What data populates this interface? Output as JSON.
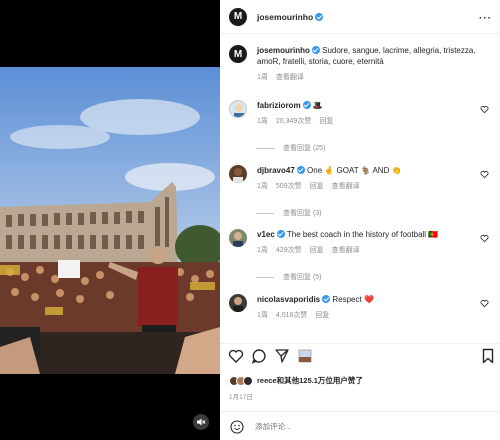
{
  "post": {
    "author": "josemourinho",
    "avatar_letter": "M"
  },
  "caption": {
    "username": "josemourinho",
    "text": "Sudore, sangue, lacrime, allegria, tristezza, amoR, fratelli, storia, cuore, eternità",
    "time": "1周",
    "see_translation": "查看翻译"
  },
  "comments": [
    {
      "username": "fabriziorom",
      "text": "🎩",
      "time": "1周",
      "likes": "20,349次赞",
      "reply": "回复",
      "translate": "",
      "view_replies": "查看回复 (25)",
      "avatar_color": "#d9e8f0"
    },
    {
      "username": "djbravo47",
      "text": "One 🤞 GOAT 🐐 AND 👏",
      "time": "1周",
      "likes": "509次赞",
      "reply": "回复",
      "translate": "查看翻译",
      "view_replies": "查看回复 (3)",
      "avatar_color": "#5a3e2b"
    },
    {
      "username": "v1ec",
      "text": "The best coach in the history of football 🇵🇹",
      "time": "1周",
      "likes": "429次赞",
      "reply": "回复",
      "translate": "查看翻译",
      "view_replies": "查看回复 (5)",
      "avatar_color": "#7a8a6a"
    },
    {
      "username": "nicolasvaporidis",
      "text": "Respect ❤️",
      "time": "1周",
      "likes": "4,016次赞",
      "reply": "回复",
      "translate": "",
      "view_replies": "",
      "avatar_color": "#3d3a36"
    }
  ],
  "likes_summary": {
    "user": "reece",
    "rest": "和其他125.1万位用户赞了"
  },
  "date": "1月17日",
  "comment_input": {
    "placeholder": "添加评论..."
  },
  "colors": {
    "verified": "#3897f0",
    "muted_text": "#8e8e8e",
    "heart_red": "#e0245e"
  }
}
